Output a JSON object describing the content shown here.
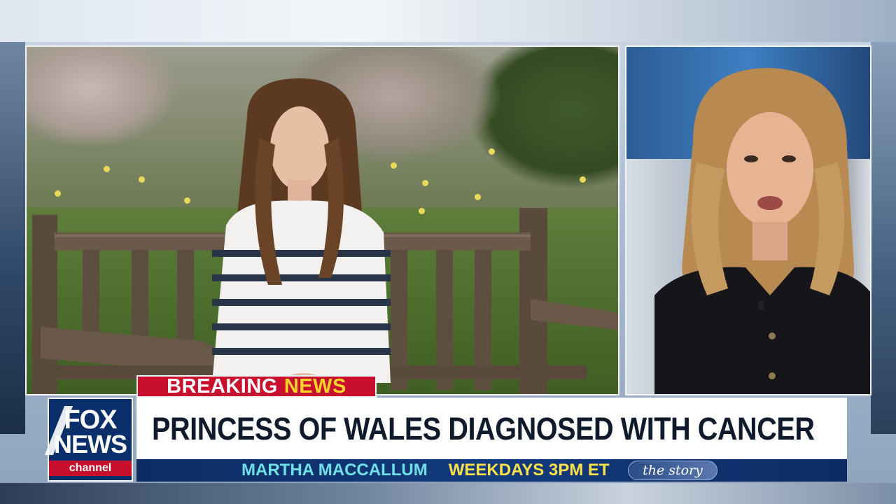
{
  "banner": {
    "breaking": "BREAKING",
    "news": "NEWS"
  },
  "headline": "PRINCESS OF WALES DIAGNOSED WITH CANCER",
  "ticker": {
    "anchor": "MARTHA MACCALLUM",
    "slot": "WEEKDAYS 3PM ET"
  },
  "show_logo": "the story",
  "network": {
    "line1": "FOX",
    "line2": "NEWS",
    "line3": "channel"
  },
  "colors": {
    "breaking_red": "#c8102e",
    "news_yellow": "#ffd42a",
    "ticker_blue": "#0d2c63",
    "anchor_cyan": "#6fe0e6"
  }
}
